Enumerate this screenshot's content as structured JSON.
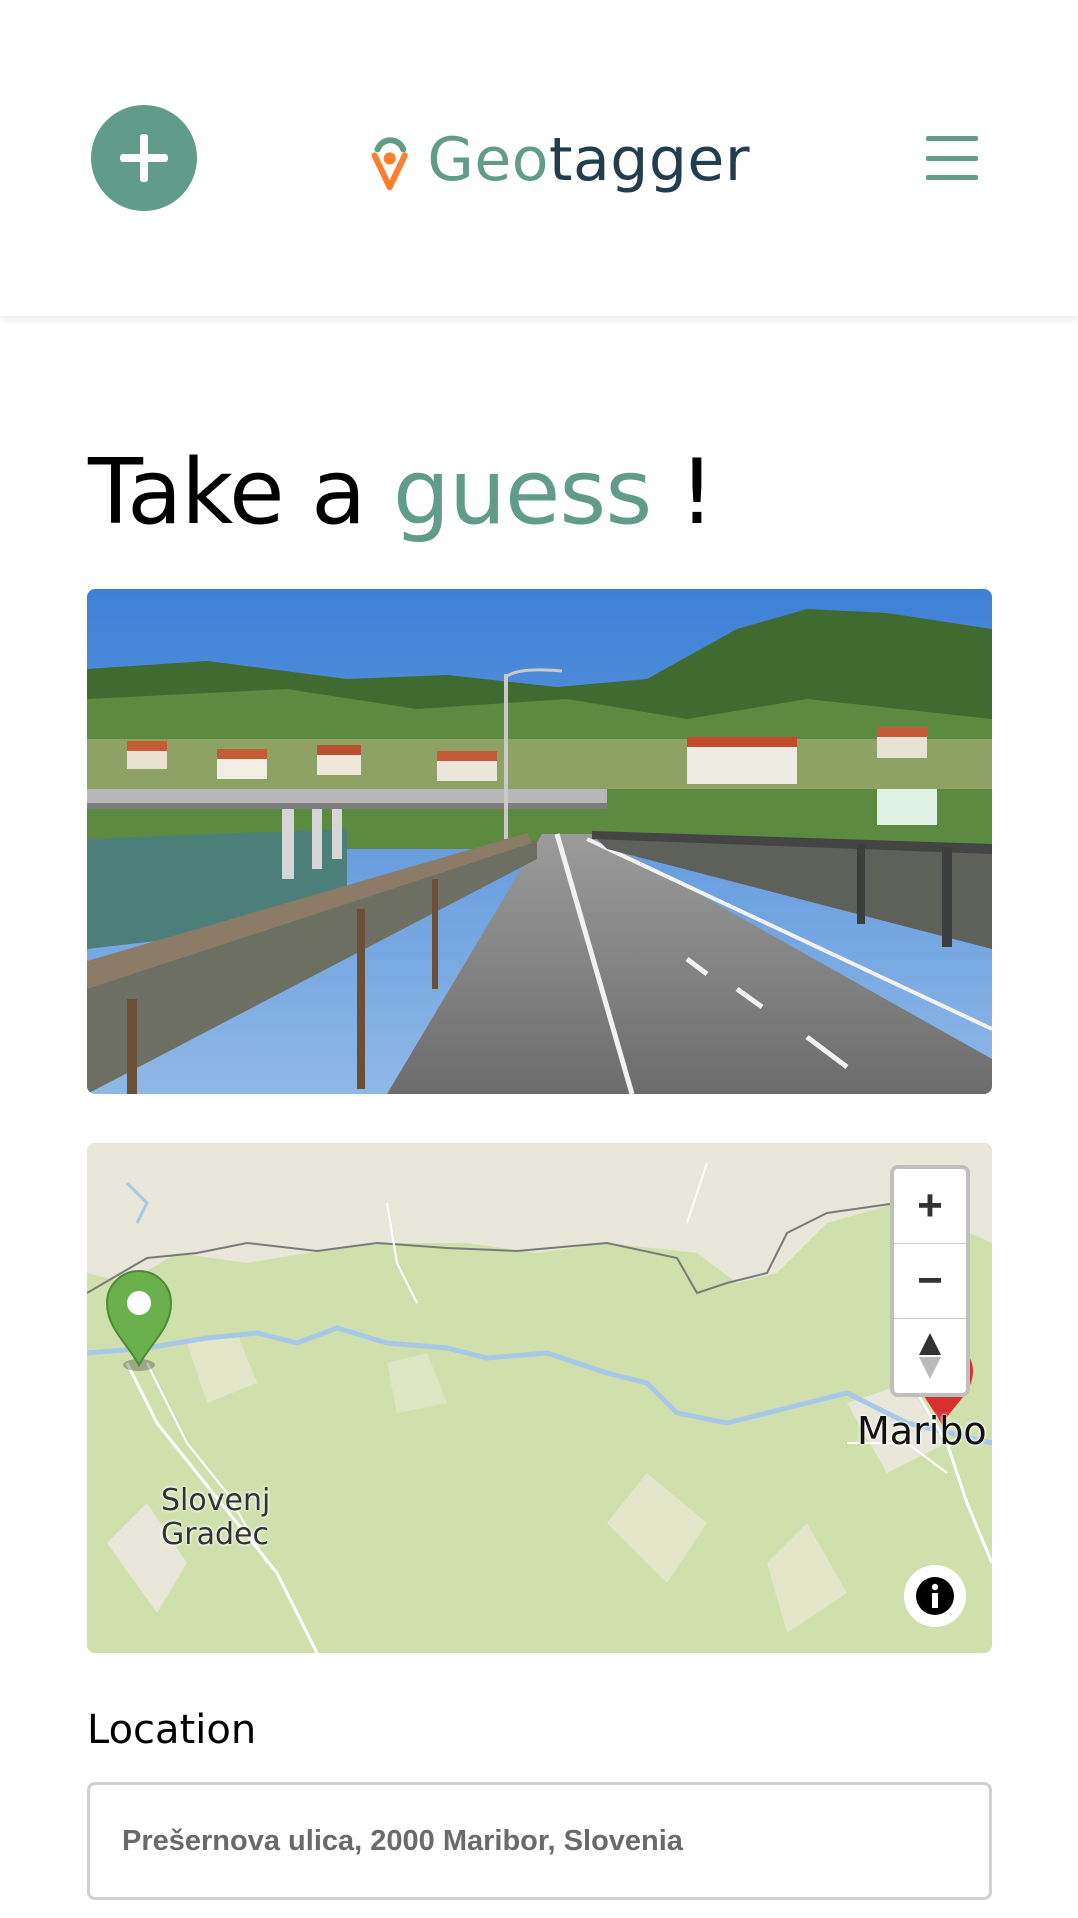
{
  "header": {
    "logo_geo": "Geo",
    "logo_tagger": "tagger",
    "brand_primary": "#619b8a",
    "brand_dark": "#233d4d",
    "brand_accent": "#fe7f2d",
    "add_icon": "plus-icon",
    "menu_icon": "hamburger-icon"
  },
  "main": {
    "title_prefix": "Take a",
    "title_accent": "guess",
    "title_suffix": "!",
    "photo_alt": "Bridge over river with road and houses on hillside",
    "map": {
      "zoom_in": "+",
      "zoom_out": "−",
      "labels": {
        "city_1_line1": "Slovenj",
        "city_1_line2": "Gradec",
        "city_2": "Maribo"
      },
      "guess_marker_color": "#6ab04c",
      "target_marker_color": "#d63031"
    },
    "location_label": "Location",
    "location_value": "Prešernova ulica, 2000 Maribor, Slovenia"
  }
}
